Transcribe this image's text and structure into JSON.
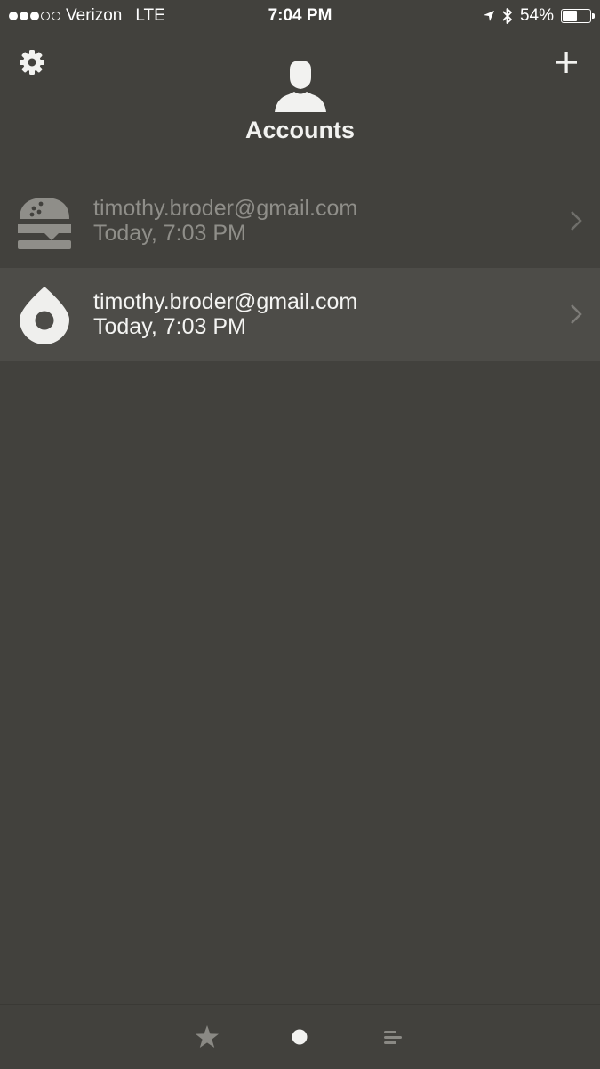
{
  "status_bar": {
    "carrier": "Verizon",
    "network": "LTE",
    "time": "7:04 PM",
    "battery": "54%",
    "battery_level": 0.54,
    "signal_bars": 3
  },
  "header": {
    "title": "Accounts",
    "settings_icon": "gear-icon",
    "add_icon": "plus-icon",
    "avatar_icon": "person-icon"
  },
  "accounts": [
    {
      "service_icon": "burger-icon",
      "email": "timothy.broder@gmail.com",
      "timestamp": "Today, 7:03 PM"
    },
    {
      "service_icon": "drop-icon",
      "email": "timothy.broder@gmail.com",
      "timestamp": "Today, 7:03 PM"
    }
  ],
  "tab_bar": {
    "tabs": [
      {
        "icon": "star-icon"
      },
      {
        "icon": "circle-icon"
      },
      {
        "icon": "list-icon"
      }
    ]
  },
  "colors": {
    "background": "#42413d",
    "selected_row": "#4d4c48",
    "text_primary": "#f2f2f0",
    "text_dim": "#8f8e89"
  }
}
